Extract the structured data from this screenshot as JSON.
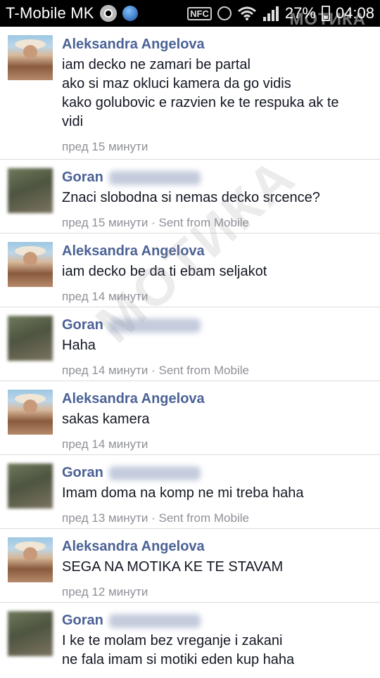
{
  "status_bar": {
    "carrier": "T-Mobile MK",
    "nfc_label": "NFC",
    "battery_percent": "27%",
    "time": "04:08",
    "watermark": "МОТИКА"
  },
  "messages": [
    {
      "sender": "Aleksandra Angelova",
      "lines": [
        "iam decko ne zamari be partal",
        "ako si maz okluci kamera da go vidis",
        "kako golubovic e razvien ke te respuka ak te",
        "vidi"
      ],
      "meta": "пред 15 минути"
    },
    {
      "sender": "Goran",
      "lines": [
        "Znaci slobodna si nemas decko srcence?"
      ],
      "meta": "пред 15 минути · Sent from Mobile"
    },
    {
      "sender": "Aleksandra Angelova",
      "lines": [
        "iam decko be da ti ebam seljakot"
      ],
      "meta": "пред 14 минути"
    },
    {
      "sender": "Goran",
      "lines": [
        "Haha"
      ],
      "meta": "пред 14 минути · Sent from Mobile"
    },
    {
      "sender": "Aleksandra Angelova",
      "lines": [
        "sakas kamera"
      ],
      "meta": "пред 14 минути"
    },
    {
      "sender": "Goran",
      "lines": [
        "Imam doma na komp ne mi treba haha"
      ],
      "meta": "пред 13 минути · Sent from Mobile"
    },
    {
      "sender": "Aleksandra Angelova",
      "lines": [
        "SEGA NA MOTIKA KE TE STAVAM"
      ],
      "meta": "пред 12 минути"
    },
    {
      "sender": "Goran",
      "lines": [
        "I ke te molam bez vreganje i zakani",
        "ne fala imam si motiki eden kup haha"
      ],
      "meta": ""
    }
  ],
  "watermark": "МОТИКА"
}
